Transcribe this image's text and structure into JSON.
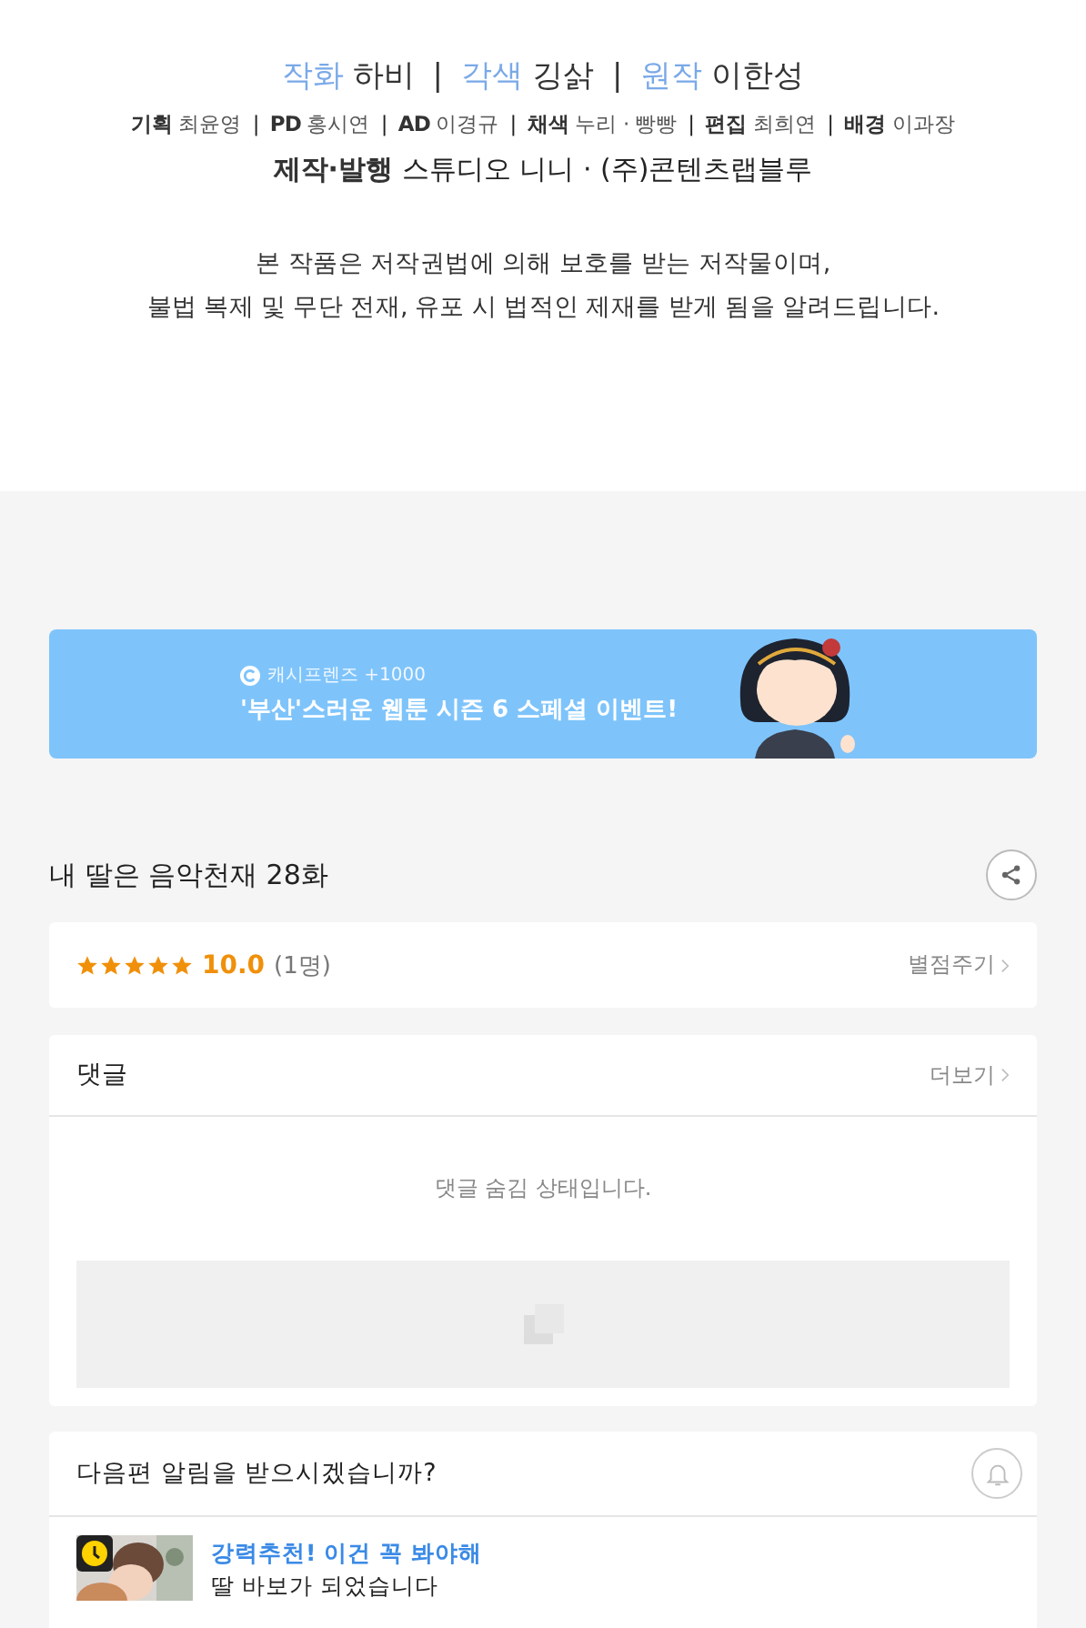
{
  "credits": {
    "main": [
      {
        "role": "작화",
        "name": "하비"
      },
      {
        "role": "각색",
        "name": "깅삵"
      },
      {
        "role": "원작",
        "name": "이한성"
      }
    ],
    "staff": [
      {
        "role": "기획",
        "name": "최윤영"
      },
      {
        "role": "PD",
        "name": "홍시연"
      },
      {
        "role": "AD",
        "name": "이경규"
      },
      {
        "role": "채색",
        "name": "누리 · 빵빵"
      },
      {
        "role": "편집",
        "name": "최희연"
      },
      {
        "role": "배경",
        "name": "이과장"
      }
    ],
    "publisher": {
      "role": "제작·발행",
      "name": "스튜디오 니니 · (주)콘텐츠랩블루"
    },
    "separator": "|"
  },
  "notice": [
    "본 작품은 저작권법에 의해 보호를 받는 저작물이며,",
    "불법 복제 및 무단 전재, 유포 시 법적인 제재를 받게 됨을 알려드립니다."
  ],
  "banner": {
    "caption": "캐시프렌즈 +1000",
    "headline": "'부산'스러운 웹툰 시즌 6 스페셜 이벤트!"
  },
  "episode_title": "내 딸은 음악천재 28화",
  "rating": {
    "stars": 5,
    "score": "10.0",
    "count": "(1명)",
    "action": "별점주기"
  },
  "comments": {
    "title": "댓글",
    "more": "더보기",
    "message": "댓글 숨김 상태입니다."
  },
  "alert": {
    "question": "다음편 알림을 받으시겠습니까?",
    "on": false
  },
  "recommendation": {
    "tag": "강력추천! 이건 꼭 봐야해",
    "title": "딸 바보가 되었습니다"
  }
}
